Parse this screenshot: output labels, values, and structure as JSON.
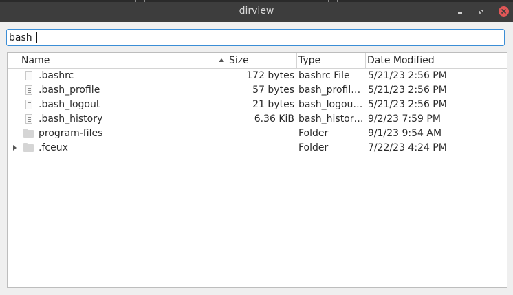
{
  "window": {
    "title": "dirview"
  },
  "search": {
    "value": "bash"
  },
  "columns": {
    "name": "Name",
    "size": "Size",
    "type": "Type",
    "date": "Date Modified"
  },
  "files": [
    {
      "name": ".bashrc",
      "size": "172 bytes",
      "type": "bashrc File",
      "date": "5/21/23 2:56 PM",
      "kind": "file-icon"
    },
    {
      "name": ".bash_profile",
      "size": "57 bytes",
      "type": "bash_profil…",
      "date": "5/21/23 2:56 PM",
      "kind": "file-icon"
    },
    {
      "name": ".bash_logout",
      "size": "21 bytes",
      "type": "bash_logou…",
      "date": "5/21/23 2:56 PM",
      "kind": "file-icon"
    },
    {
      "name": ".bash_history",
      "size": "6.36 KiB",
      "type": "bash_histor…",
      "date": "9/2/23 7:59 PM",
      "kind": "file-icon"
    },
    {
      "name": "program-files",
      "size": "",
      "type": "Folder",
      "date": "9/1/23 9:54 AM",
      "kind": "folder-icon"
    },
    {
      "name": ".fceux",
      "size": "",
      "type": "Folder",
      "date": "7/22/23 4:24 PM",
      "kind": "folder-icon",
      "expandable": true
    }
  ],
  "colors": {
    "titlebar": "#3d3d3d",
    "accent": "#3b8ed6",
    "close": "#e05757"
  }
}
